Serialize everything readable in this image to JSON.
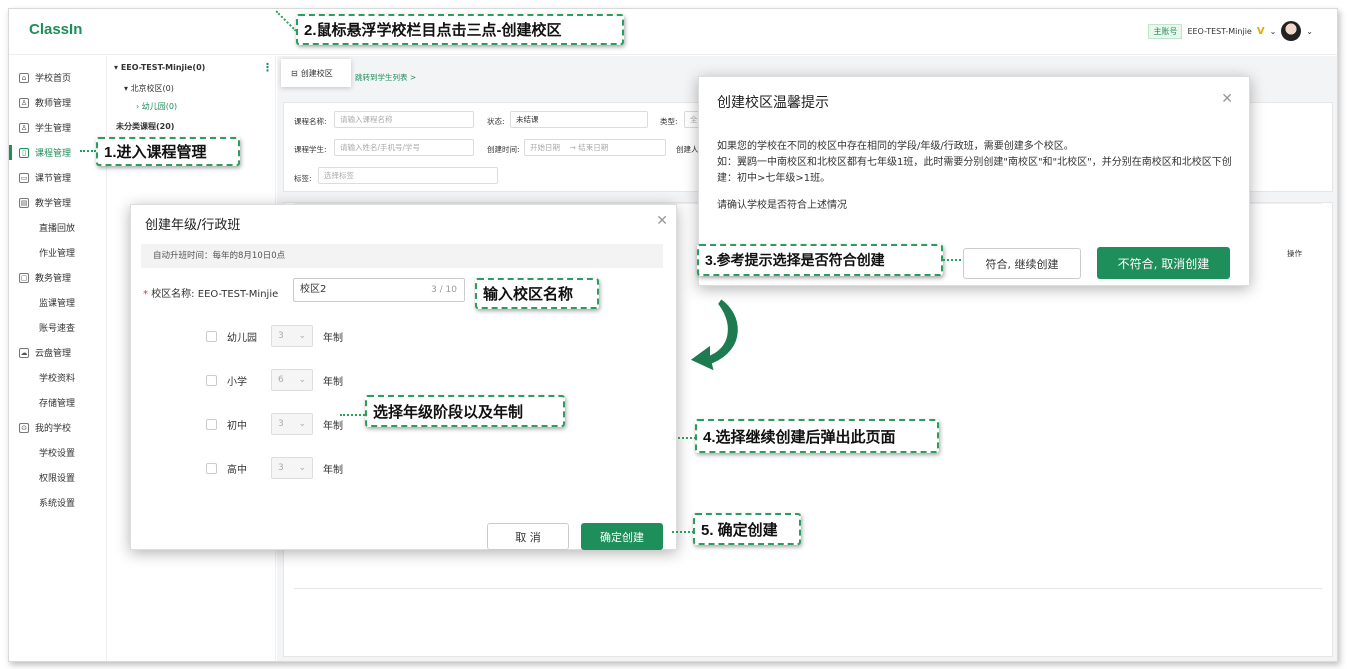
{
  "app": {
    "logo": "ClassIn"
  },
  "account": {
    "badge": "主账号",
    "name": "EEO-TEST-Minjie",
    "v": "V"
  },
  "sidebar": {
    "items": [
      {
        "label": "学校首页",
        "icon": "home-icon",
        "glyph": "⌂"
      },
      {
        "label": "教师管理",
        "icon": "user-icon",
        "glyph": "♙"
      },
      {
        "label": "学生管理",
        "icon": "student-icon",
        "glyph": "♙"
      },
      {
        "label": "课程管理",
        "icon": "course-icon",
        "glyph": "▯"
      },
      {
        "label": "课节管理",
        "icon": "lesson-icon",
        "glyph": "▭"
      },
      {
        "label": "教学管理",
        "icon": "teaching-icon",
        "glyph": "▤"
      },
      {
        "label": "直播回放"
      },
      {
        "label": "作业管理"
      },
      {
        "label": "教务管理",
        "icon": "affairs-icon",
        "glyph": "▢"
      },
      {
        "label": "监课管理"
      },
      {
        "label": "账号速查"
      },
      {
        "label": "云盘管理",
        "icon": "cloud-icon",
        "glyph": "☁"
      },
      {
        "label": "学校资料"
      },
      {
        "label": "存储管理"
      },
      {
        "label": "我的学校",
        "icon": "school-icon",
        "glyph": "⊙"
      },
      {
        "label": "学校设置"
      },
      {
        "label": "权限设置"
      },
      {
        "label": "系统设置"
      }
    ]
  },
  "tree": {
    "root": "EEO-TEST-Minjie(0)",
    "campus": "北京校区(0)",
    "kindergarten": "幼儿园(0)",
    "uncategorized": "未分类课程(20)",
    "menu_create": "创建校区",
    "link": "跳转到学生列表 >"
  },
  "filters": {
    "course_name_label": "课程名称:",
    "course_name_ph": "请输入课程名称",
    "status_label": "状态:",
    "status_value": "未结课",
    "type_label": "类型:",
    "type_value": "全",
    "student_label": "课程学生:",
    "student_ph": "请输入姓名/手机号/学号",
    "time_label": "创建时间:",
    "start_ph": "开始日期",
    "arrow": "→",
    "end_ph": "结束日期",
    "creator_label": "创建人",
    "tag_label": "标签:",
    "tag_ph": "选择标签"
  },
  "table": {
    "op_header": "操作"
  },
  "warn_dialog": {
    "title": "创建校区温馨提示",
    "body1": "如果您的学校在不同的校区中存在相同的学段/年级/行政班，需要创建多个校区。",
    "body2": "如：翼鸥一中南校区和北校区都有七年级1班，此时需要分别创建\"南校区\"和\"北校区\"，并分别在南校区和北校区下创建：初中>七年级>1班。",
    "body3": "请确认学校是否符合上述情况",
    "continue_btn": "符合, 继续创建",
    "cancel_btn": "不符合, 取消创建"
  },
  "grade_dialog": {
    "title": "创建年级/行政班",
    "auto_promote": "自动升班时间：每年的8月10日0点",
    "campus_label": "校区名称:",
    "school_name": "EEO-TEST-Minjie",
    "campus_value": "校区2",
    "counter": "3 / 10",
    "suffix": "年制",
    "stages": [
      {
        "name": "幼儿园",
        "years": "3"
      },
      {
        "name": "小学",
        "years": "6"
      },
      {
        "name": "初中",
        "years": "3"
      },
      {
        "name": "高中",
        "years": "3"
      }
    ],
    "cancel_btn": "取 消",
    "confirm_btn": "确定创建"
  },
  "callouts": {
    "c1": "1.进入课程管理",
    "c2": "2.鼠标悬浮学校栏目点击三点-创建校区",
    "c3": "3.参考提示选择是否符合创建",
    "c_name": "输入校区名称",
    "c_grade": "选择年级阶段以及年制",
    "c4": "4.选择继续创建后弹出此页面",
    "c5": "5. 确定创建"
  }
}
